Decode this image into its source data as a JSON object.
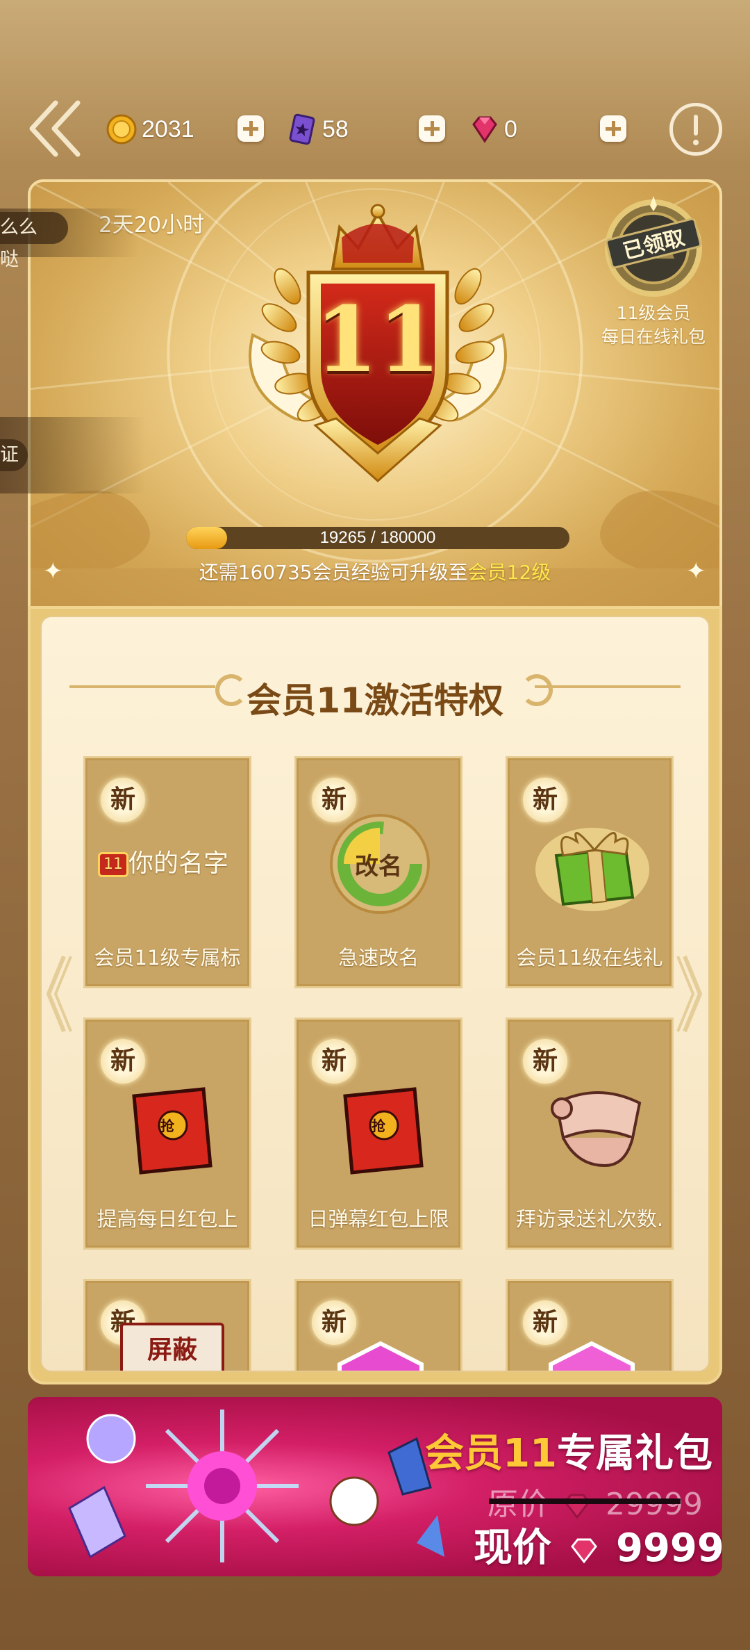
{
  "topbar": {
    "coins": "2031",
    "cards": "58",
    "gems": "0"
  },
  "header": {
    "timer": "2天20小时",
    "level": "11",
    "daily_gift": {
      "status": "已领取",
      "line1": "11级会员",
      "line2": "每日在线礼包"
    },
    "exp": {
      "text": "19265 / 180000",
      "current": 19265,
      "max": 180000
    },
    "hint_prefix": "还需160735会员经验可升级至",
    "hint_target": "会员12级"
  },
  "side_bubbles": [
    "么么哒",
    "证"
  ],
  "privileges": {
    "title": "会员11激活特权",
    "new_badge": "新",
    "name_preview": "你的名字",
    "rename_art": "改名",
    "redpacket_art": "抢",
    "block_art": "屏蔽",
    "cards": [
      {
        "label": "会员11级专属标",
        "art": "name-tag"
      },
      {
        "label": "急速改名",
        "art": "rename"
      },
      {
        "label": "会员11级在线礼",
        "art": "gift-box"
      },
      {
        "label": "提高每日红包上",
        "art": "red-packet"
      },
      {
        "label": "日弹幕红包上限",
        "art": "red-packet"
      },
      {
        "label": "拜访录送礼次数.",
        "art": "scroll"
      },
      {
        "label": "",
        "art": "block"
      },
      {
        "label": "",
        "art": "pink-badge"
      },
      {
        "label": "",
        "art": "heart-badge"
      }
    ]
  },
  "banner": {
    "title_level": "会员11",
    "title_rest": "专属礼包",
    "orig_label": "原价",
    "orig_price": "29999",
    "now_label": "现价",
    "now_price": "9999"
  },
  "colors": {
    "gold": "#ffc837",
    "highlight": "#ffe84e",
    "banner_pink": "#d31f66",
    "panel_brown": "#7a4a16"
  }
}
